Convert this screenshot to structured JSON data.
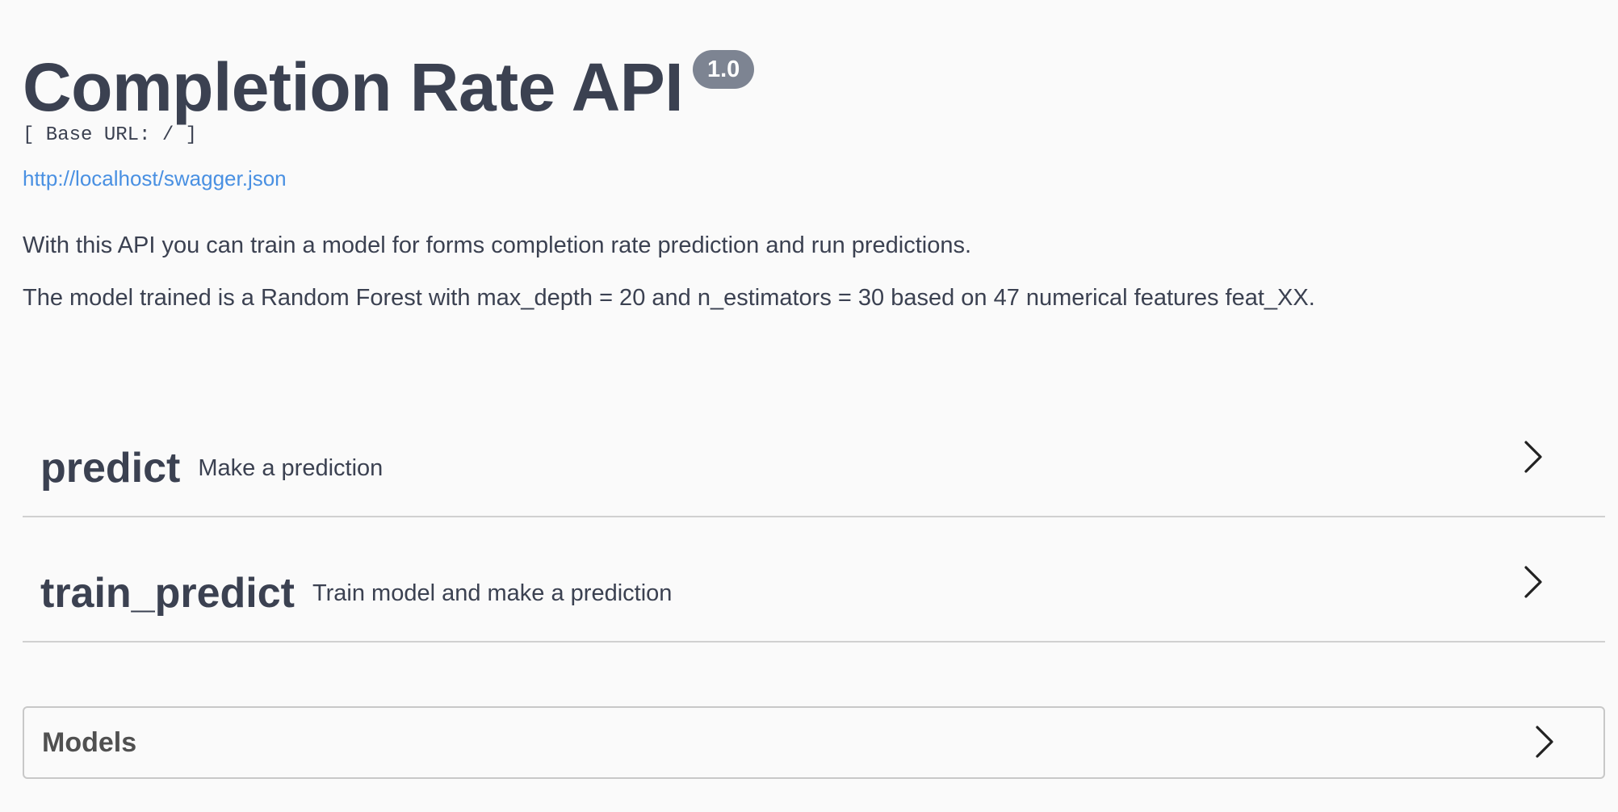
{
  "info": {
    "title": "Completion Rate API",
    "version": "1.0",
    "base_url": "[ Base URL: / ]",
    "spec_link": "http://localhost/swagger.json",
    "description": [
      "With this API you can train a model for forms completion rate prediction and run predictions.",
      "The model trained is a Random Forest with max_depth = 20 and n_estimators = 30 based on 47 numerical features feat_XX."
    ]
  },
  "tags": [
    {
      "name": "predict",
      "description": "Make a prediction",
      "icon": "chevron-right-icon"
    },
    {
      "name": "train_predict",
      "description": "Train model and make a prediction",
      "icon": "chevron-right-icon"
    }
  ],
  "models": {
    "title": "Models",
    "icon": "chevron-right-icon"
  },
  "colors": {
    "background": "#fafafa",
    "text": "#3b4151",
    "link": "#4990e2",
    "badge": "#7d8492",
    "divider": "#d0d0d0"
  }
}
